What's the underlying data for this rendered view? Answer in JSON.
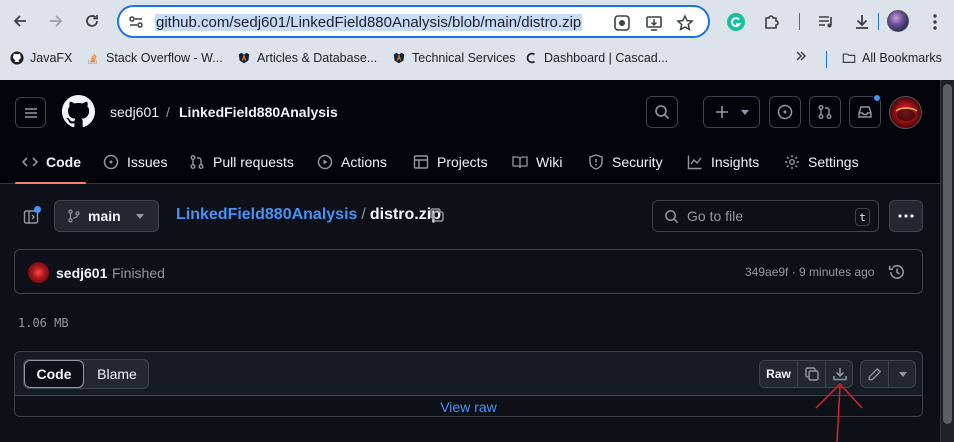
{
  "browser": {
    "url": "github.com/sedj601/LinkedField880Analysis/blob/main/distro.zip",
    "bookmarks": [
      {
        "label": "JavaFX",
        "icon": "github-icon"
      },
      {
        "label": "Stack Overflow - W...",
        "icon": "stackoverflow-icon"
      },
      {
        "label": "Articles & Database...",
        "icon": "auburn-icon"
      },
      {
        "label": "Technical Services",
        "icon": "auburn-icon"
      },
      {
        "label": "Dashboard | Cascad...",
        "icon": "cascade-icon"
      }
    ],
    "all_bookmarks": "All Bookmarks",
    "accent": "#1a73e8"
  },
  "header": {
    "owner": "sedj601",
    "separator": "/",
    "repo": "LinkedField880Analysis"
  },
  "tabs": [
    {
      "label": "Code",
      "icon": "code-icon",
      "active": true
    },
    {
      "label": "Issues",
      "icon": "issue-icon"
    },
    {
      "label": "Pull requests",
      "icon": "pull-request-icon"
    },
    {
      "label": "Actions",
      "icon": "play-icon"
    },
    {
      "label": "Projects",
      "icon": "table-icon"
    },
    {
      "label": "Wiki",
      "icon": "book-icon"
    },
    {
      "label": "Security",
      "icon": "shield-icon"
    },
    {
      "label": "Insights",
      "icon": "graph-icon"
    },
    {
      "label": "Settings",
      "icon": "gear-icon"
    }
  ],
  "file": {
    "branch": "main",
    "repo_link": "LinkedField880Analysis",
    "path_sep": "/",
    "filename": "distro.zip",
    "goto_placeholder": "Go to file",
    "goto_shortcut": "t",
    "size": "1.06 MB"
  },
  "commit": {
    "author": "sedj601",
    "message": "Finished",
    "meta": "349ae9f · 9 minutes ago"
  },
  "viewer": {
    "code_tab": "Code",
    "blame_tab": "Blame",
    "raw_label": "Raw",
    "view_raw": "View raw"
  },
  "colors": {
    "link": "#4493f8",
    "tab_underline": "#f78166",
    "annotation_arrow": "#d9202a"
  }
}
